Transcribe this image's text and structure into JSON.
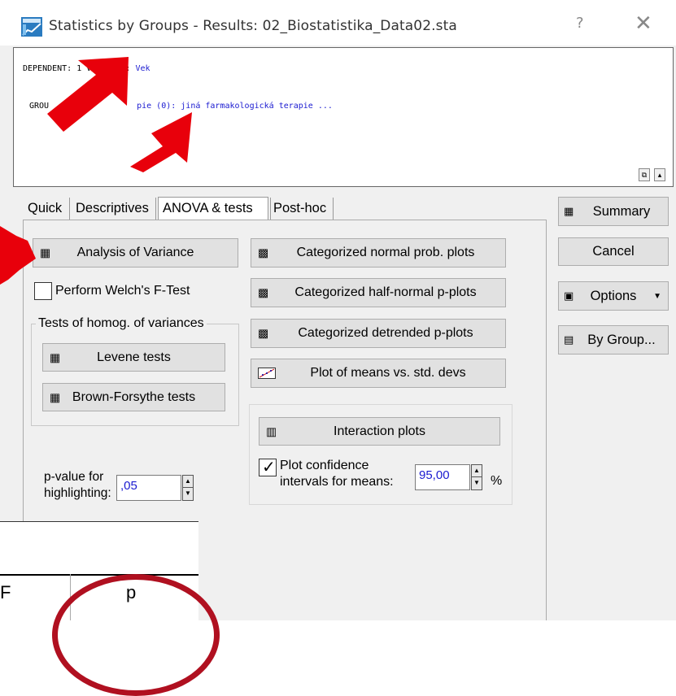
{
  "window": {
    "title": "Statistics by Groups - Results: 02_Biostatistika_Data02.sta",
    "help_glyph": "?",
    "close_glyph": "✕"
  },
  "info": {
    "dependent_prefix": "DEPENDENT: 1 variable: ",
    "dependent_var": "Vek",
    "group_prefix": "GROU",
    "group_mid": "pie (0): jiná farmakologická terapie ...",
    "annotation_number": "1"
  },
  "tabs": [
    {
      "label": "Quick"
    },
    {
      "label": "Descriptives"
    },
    {
      "label": "ANOVA & tests"
    },
    {
      "label": "Post-hoc"
    }
  ],
  "left": {
    "anova_label": "Analysis of Variance",
    "welch_label": "Perform Welch's F-Test",
    "homog_title": "Tests of homog. of variances",
    "levene_label": "Levene tests",
    "brown_label": "Brown-Forsythe tests",
    "pvalue_label_1": "p-value for",
    "pvalue_label_2": "highlighting:",
    "pvalue_value": ",05"
  },
  "middle": {
    "normal_plots": "Categorized normal prob. plots",
    "halfnormal_plots": "Categorized half-normal p-plots",
    "detrended_plots": "Categorized detrended  p-plots",
    "means_vs_sd": "Plot of means vs. std. devs",
    "interaction_plots": "Interaction plots",
    "plot_ci_1": "Plot confidence",
    "plot_ci_2": "intervals for means:",
    "ci_value": "95,00",
    "ci_unit": "%"
  },
  "right": {
    "summary": "Summary",
    "cancel": "Cancel",
    "options": "Options",
    "bygroup": "By Group..."
  },
  "overlay": {
    "col_f": "F",
    "col_p": "p"
  },
  "colors": {
    "arrow_red": "#e8000b",
    "circle_red": "#b01020",
    "value_blue": "#1a1ad0"
  }
}
